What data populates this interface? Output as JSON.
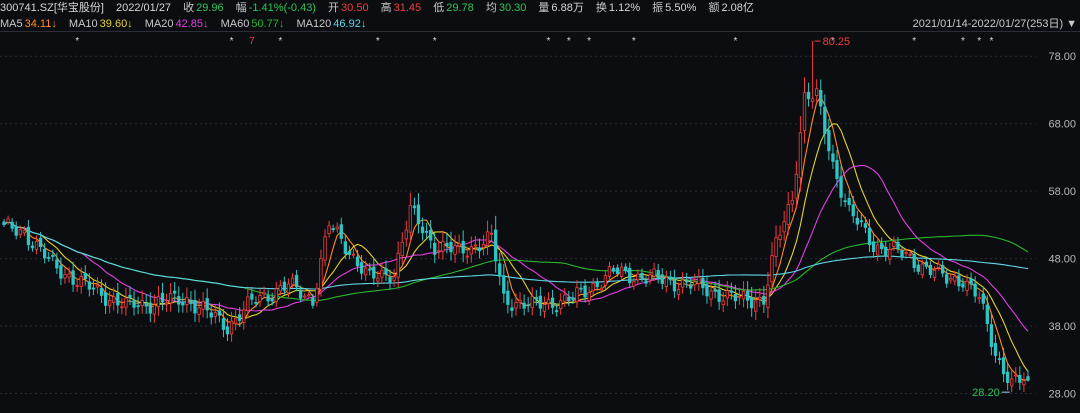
{
  "header": {
    "code": "300741.SZ[华宝股份]",
    "date": "2022/01/27",
    "close": {
      "label": "收",
      "value": "29.96"
    },
    "amplitude_change": {
      "label": "幅",
      "value": "-1.41%(-0.43)"
    },
    "open": {
      "label": "开",
      "value": "30.50"
    },
    "high": {
      "label": "高",
      "value": "31.45"
    },
    "low": {
      "label": "低",
      "value": "29.78"
    },
    "average": {
      "label": "均",
      "value": "30.30"
    },
    "volume": {
      "label": "量",
      "value": "6.88万"
    },
    "turnover": {
      "label": "换",
      "value": "1.12%"
    },
    "swing": {
      "label": "振",
      "value": "5.50%"
    },
    "amount": {
      "label": "额",
      "value": "2.08亿"
    }
  },
  "ma_legend": [
    {
      "label": "MA5",
      "value": "34.11↓",
      "color": "#ff8c1a"
    },
    {
      "label": "MA10",
      "value": "39.60↓",
      "color": "#e3d22c"
    },
    {
      "label": "MA20",
      "value": "42.85↓",
      "color": "#e040e0"
    },
    {
      "label": "MA60",
      "value": "50.77↓",
      "color": "#2bb52b"
    },
    {
      "label": "MA120",
      "value": "46.92↓",
      "color": "#5fd8e8"
    }
  ],
  "date_range": "2021/01/14-2022/01/27(253日)",
  "date_range_icon": "triangle-down-icon",
  "colors": {
    "up": "#f23d3d",
    "down": "#2ec4c4",
    "grid": "#2a2d36",
    "axis_text": "#b8b8b8"
  },
  "chart_data": {
    "type": "candlestick",
    "ylim": [
      26,
      81
    ],
    "y_ticks": [
      78.0,
      68.0,
      58.0,
      48.0,
      38.0,
      28.0
    ],
    "y_tick_labels": [
      "78.00",
      "68.00",
      "58.00",
      "48.00",
      "38.00",
      "28.00"
    ],
    "high_annotation": {
      "value": 80.25,
      "label": "80.25",
      "candle_index": 199
    },
    "low_annotation": {
      "value": 28.2,
      "label": "28.20",
      "candle_index": 248
    },
    "trading_days": 253,
    "event_markers": {
      "symbol": "*",
      "highlight_symbol": "7",
      "indices": [
        18,
        56,
        61,
        68,
        92,
        106,
        134,
        139,
        144,
        155,
        180,
        204,
        224,
        236,
        240,
        243
      ],
      "highlight_indices": [
        61
      ]
    },
    "key_closes": [
      [
        0,
        52.5
      ],
      [
        5,
        52
      ],
      [
        12,
        47
      ],
      [
        20,
        44
      ],
      [
        30,
        41
      ],
      [
        45,
        42
      ],
      [
        55,
        38
      ],
      [
        62,
        42
      ],
      [
        70,
        44
      ],
      [
        76,
        42
      ],
      [
        80,
        53
      ],
      [
        84,
        50
      ],
      [
        90,
        45
      ],
      [
        96,
        46
      ],
      [
        100,
        55
      ],
      [
        106,
        50
      ],
      [
        112,
        49
      ],
      [
        120,
        51
      ],
      [
        123,
        42
      ],
      [
        130,
        41
      ],
      [
        140,
        42
      ],
      [
        150,
        46
      ],
      [
        160,
        45
      ],
      [
        170,
        44
      ],
      [
        180,
        42
      ],
      [
        187,
        42
      ],
      [
        190,
        50
      ],
      [
        194,
        57
      ],
      [
        197,
        72
      ],
      [
        200,
        72
      ],
      [
        204,
        62
      ],
      [
        208,
        55
      ],
      [
        214,
        50
      ],
      [
        220,
        49
      ],
      [
        226,
        47
      ],
      [
        232,
        45
      ],
      [
        236,
        45
      ],
      [
        240,
        42
      ],
      [
        244,
        34
      ],
      [
        248,
        29.5
      ],
      [
        252,
        29.96
      ]
    ]
  }
}
